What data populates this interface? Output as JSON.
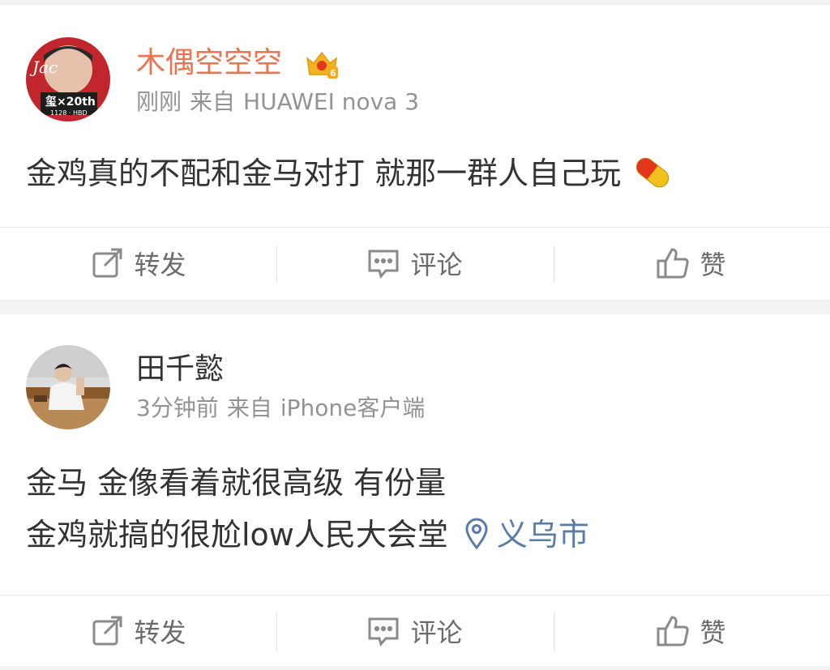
{
  "posts": [
    {
      "username": "木偶空空空",
      "time": "刚刚",
      "source_prefix": "来自",
      "source": "HUAWEI nova 3",
      "avatar_text_1": "Jac",
      "avatar_text_2": "玺×20th",
      "avatar_text_3": "1128 · HBD",
      "badge_level": "6",
      "content_lines": [
        "金鸡真的不配和金马对打 就那一群人自己玩"
      ],
      "emoji": "pill-emoji",
      "actions": {
        "repost": "转发",
        "comment": "评论",
        "like": "赞"
      }
    },
    {
      "username": "田千懿",
      "time": "3分钟前",
      "source_prefix": "来自",
      "source": "iPhone客户端",
      "content_lines": [
        "金马 金像看着就很高级 有份量",
        "金鸡就搞的很尬low人民大会堂"
      ],
      "location": "义乌市",
      "actions": {
        "repost": "转发",
        "comment": "评论",
        "like": "赞"
      }
    }
  ],
  "colors": {
    "vip_name": "#eb7350",
    "name": "#333333",
    "meta": "#939393",
    "location": "#5b7ca6",
    "action": "#6b6b6b"
  },
  "icons": [
    "repost-icon",
    "comment-icon",
    "like-icon",
    "location-pin-icon",
    "vip-crown-icon"
  ]
}
